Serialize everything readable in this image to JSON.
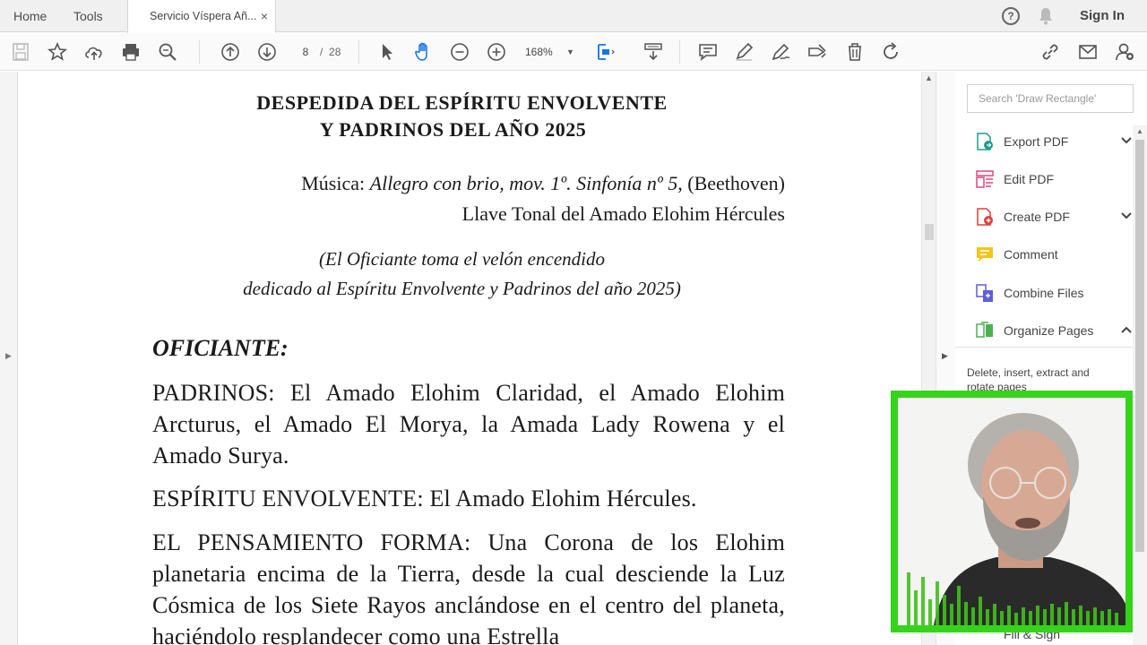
{
  "tabs": {
    "home": "Home",
    "tools": "Tools",
    "document": "Servicio Víspera Añ...",
    "close": "×"
  },
  "account": {
    "help": "?",
    "sign_in": "Sign In"
  },
  "toolbar": {
    "page_current": "8",
    "page_sep": "/",
    "page_total": "28",
    "zoom": "168%",
    "icons": [
      "save-icon",
      "star-icon",
      "upload-icon",
      "print-icon",
      "search-icon",
      "prev-page-icon",
      "next-page-icon",
      "select-cursor-icon",
      "hand-icon",
      "zoom-out-icon",
      "zoom-in-icon",
      "fit-page-icon",
      "scroll-mode-icon",
      "comment-icon",
      "pen-icon",
      "sign-icon",
      "stamp-icon",
      "delete-icon",
      "rotate-icon",
      "link-icon",
      "mail-icon",
      "add-user-icon"
    ]
  },
  "document": {
    "title_line1": "DESPEDIDA DEL ESPÍRITU ENVOLVENTE",
    "title_line2": "Y PADRINOS DEL AÑO 2025",
    "music_label": "Música:",
    "music_italic": "Allegro con brio, mov. 1º. Sinfonía nº 5,",
    "music_composer": "(Beethoven)",
    "key_line": "Llave Tonal del Amado Elohim Hércules",
    "rubric_line1": "(El Oficiante toma el velón encendido",
    "rubric_line2": "dedicado al Espíritu Envolvente y Padrinos del año 2025)",
    "speaker": "OFICIANTE:",
    "para1": "PADRINOS: El Amado Elohim Claridad, el Amado Elohim Arcturus, el Amado El Morya, la Amada Lady Rowena y el Amado Surya.",
    "para2": "ESPÍRITU ENVOLVENTE: El Amado Elohim Hércules.",
    "para3": "EL PENSAMIENTO FORMA: Una Corona de los Elohim planetaria encima de la Tierra, desde la cual desciende la Luz Cósmica de los Siete Rayos anclándose en el centro del planeta, haciéndolo resplandecer como una Estrella"
  },
  "right_pane": {
    "search_placeholder": "Search 'Draw Rectangle'",
    "tools": {
      "export": "Export PDF",
      "edit": "Edit PDF",
      "create": "Create PDF",
      "comment": "Comment",
      "combine": "Combine Files",
      "organize": "Organize Pages"
    },
    "organize_desc": "Delete, insert, extract and rotate pages",
    "fill_sign": "Fill & Sign"
  },
  "colors": {
    "webcam_border": "#35d41b",
    "export_icon": "#1f9e8c",
    "edit_icon": "#e0457b",
    "create_icon": "#e03c3c",
    "comment_icon": "#f5c518",
    "combine_icon": "#5d5fd6",
    "organize_icon": "#4caf50"
  }
}
